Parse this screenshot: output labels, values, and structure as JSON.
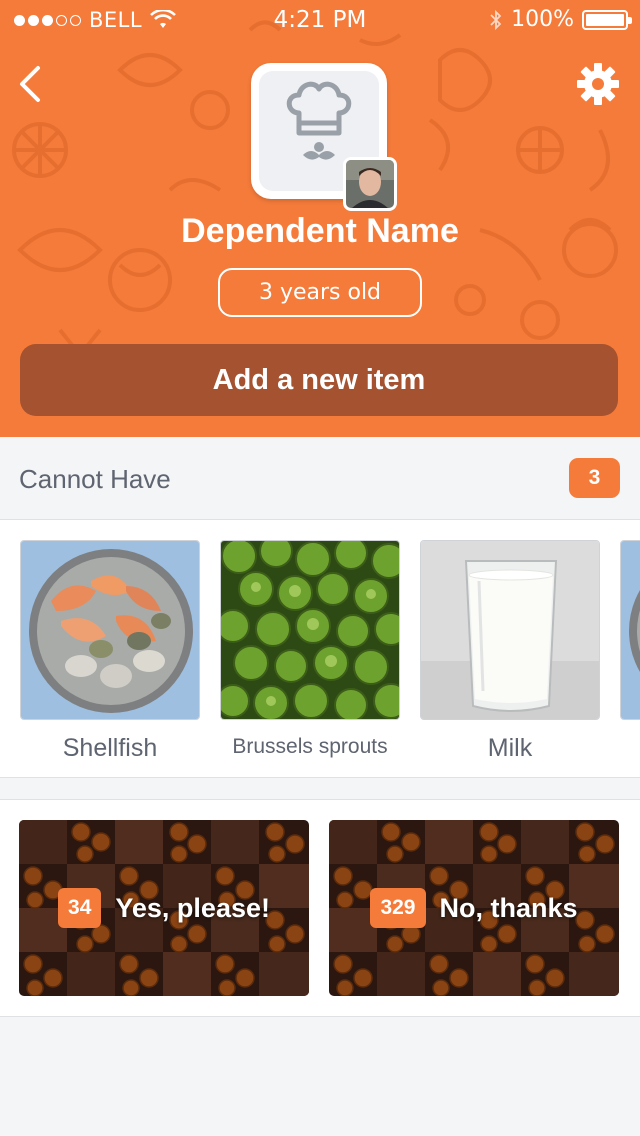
{
  "status_bar": {
    "carrier": "BELL",
    "time": "4:21 PM",
    "battery": "100%",
    "signal_bars": 3,
    "signal_total": 5
  },
  "header": {
    "dependent_name": "Dependent Name",
    "age": "3 years old",
    "add_button_label": "Add a new item",
    "back_icon": "chevron-left-icon",
    "settings_icon": "gear-icon",
    "avatar_icon": "chef-hat-icon"
  },
  "cannot_have": {
    "title": "Cannot Have",
    "count": "3",
    "items": [
      {
        "label": "Shellfish"
      },
      {
        "label": "Brussels sprouts"
      },
      {
        "label": "Milk"
      }
    ]
  },
  "votes": {
    "yes": {
      "count": "34",
      "label": "Yes, please!"
    },
    "no": {
      "count": "329",
      "label": "No, thanks"
    }
  },
  "colors": {
    "brand_orange": "#f47b3a",
    "button_brown": "#a4522f",
    "background": "#f4f5f7",
    "text_gray": "#5e6470"
  }
}
